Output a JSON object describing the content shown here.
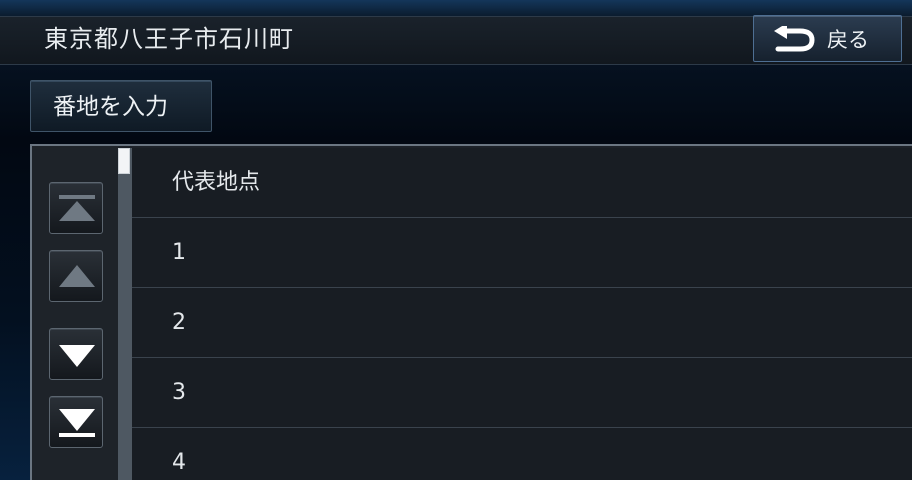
{
  "header": {
    "title": "東京都八王子市石川町",
    "back_label": "戻る"
  },
  "toolbar": {
    "address_input_label": "番地を入力"
  },
  "list": {
    "items": [
      {
        "label": "代表地点"
      },
      {
        "label": "1"
      },
      {
        "label": "2"
      },
      {
        "label": "3"
      },
      {
        "label": "4"
      }
    ]
  },
  "scrollbar": {
    "position": 0
  },
  "icons": {
    "back": "return-arrow-icon",
    "first_page": "scroll-top-icon",
    "page_up": "scroll-up-icon",
    "page_down": "scroll-down-icon",
    "last_page": "scroll-bottom-icon"
  },
  "colors": {
    "accent_border": "#4e6f93",
    "text": "#e8ecef",
    "list_background": "#181d23"
  }
}
